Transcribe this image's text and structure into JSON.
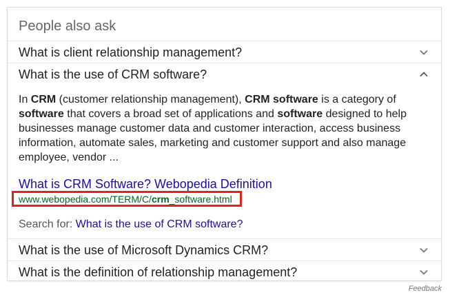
{
  "panel": {
    "heading": "People also ask",
    "questions": [
      {
        "label": "What is client relationship management?",
        "expanded": false
      },
      {
        "label": "What is the use of CRM software?",
        "expanded": true
      },
      {
        "label": "What is the use of Microsoft Dynamics CRM?",
        "expanded": false
      },
      {
        "label": "What is the definition of relationship management?",
        "expanded": false
      }
    ],
    "answer": {
      "segments": [
        {
          "text": "In ",
          "bold": false
        },
        {
          "text": "CRM",
          "bold": true
        },
        {
          "text": " (customer relationship management), ",
          "bold": false
        },
        {
          "text": "CRM software",
          "bold": true
        },
        {
          "text": " is a category of ",
          "bold": false
        },
        {
          "text": "software",
          "bold": true
        },
        {
          "text": " that covers a broad set of applications and ",
          "bold": false
        },
        {
          "text": "software",
          "bold": true
        },
        {
          "text": " designed to help businesses manage customer data and customer interaction, access business information, automate sales, marketing and customer support and also manage employee, vendor ...",
          "bold": false
        }
      ],
      "source_title": "What is CRM Software? Webopedia Definition",
      "source_url": {
        "prefix": "www.webopedia.com/TERM/C/",
        "bold": "crm",
        "suffix": "_software.html"
      },
      "search_for_label": "Search for:",
      "search_for_link": "What is the use of CRM software?"
    }
  },
  "footer": {
    "feedback": "Feedback"
  },
  "colors": {
    "link": "#1a0dab",
    "url": "#006621",
    "highlight_border": "#e2231a",
    "heading": "#666666"
  },
  "icons": {
    "collapsed": "chevron-down-icon",
    "expanded": "chevron-up-icon"
  }
}
